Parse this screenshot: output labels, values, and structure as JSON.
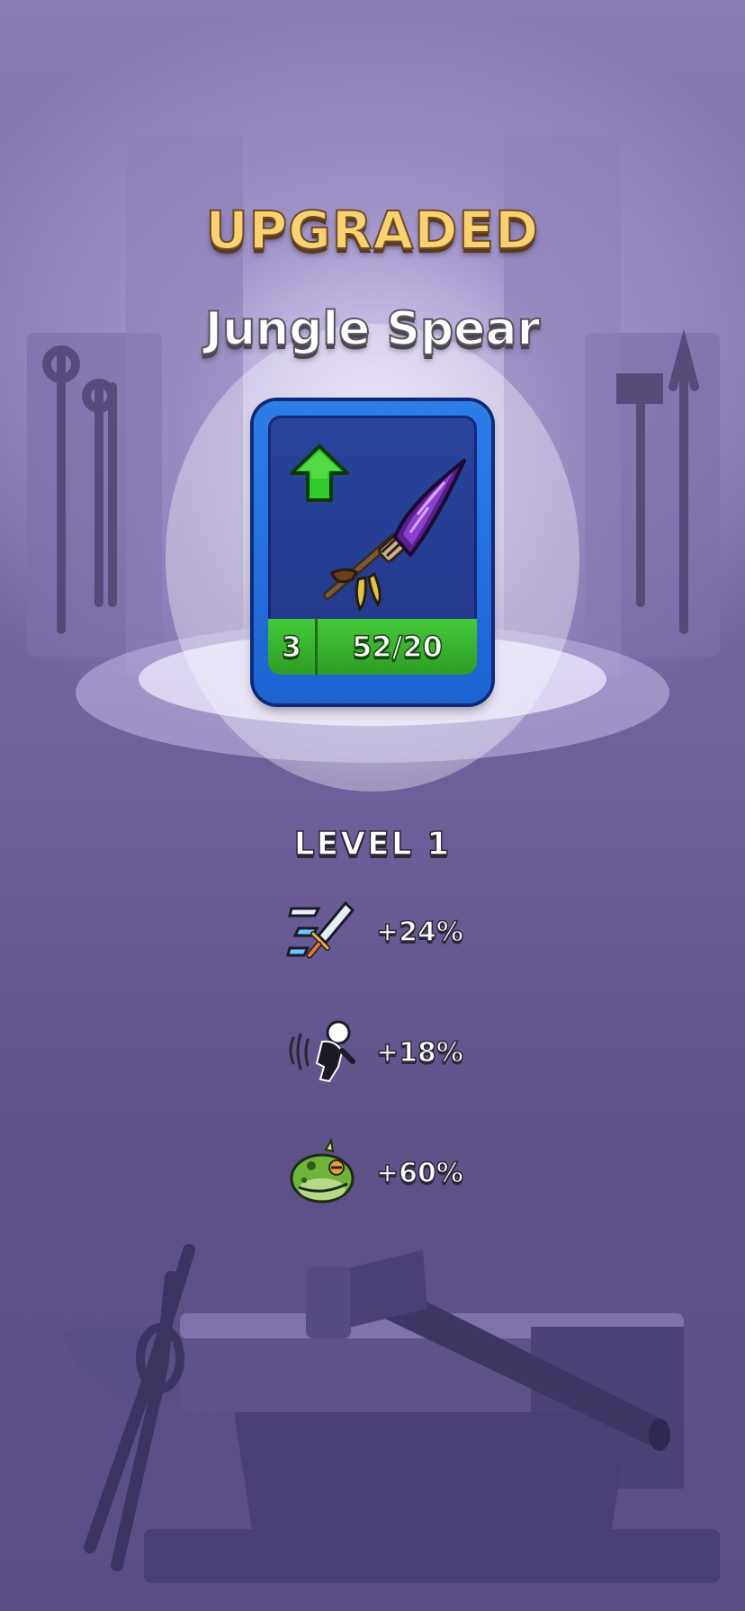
{
  "header": {
    "title": "UPGRADED",
    "item_name": "Jungle Spear"
  },
  "card": {
    "level": "3",
    "progress": "52/20",
    "weapon_icon": "jungle-spear-icon",
    "badge_icon": "upgrade-arrow-icon",
    "colors": {
      "frame": "#2d7de8",
      "inner": "#22378a",
      "footer": "#3cb92f",
      "arrow": "#2ecb2a"
    }
  },
  "stats": {
    "level_label": "LEVEL 1",
    "items": [
      {
        "icon": "attack-speed-icon",
        "value": "+24%"
      },
      {
        "icon": "knockback-icon",
        "value": "+18%"
      },
      {
        "icon": "toad-icon",
        "value": "+60%"
      }
    ]
  },
  "colors": {
    "title_gold": "#fbd36e",
    "background": "#6a5c96"
  }
}
